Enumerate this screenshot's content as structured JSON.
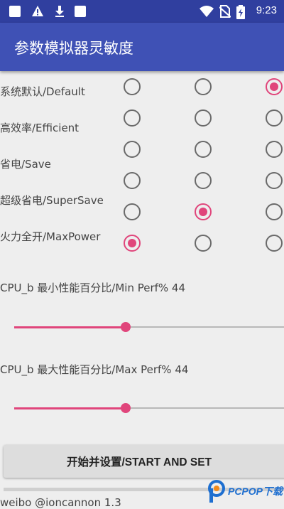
{
  "status_bar": {
    "time": "9:23",
    "left_icons": [
      "square-icon",
      "warning-icon",
      "download-icon",
      "square-icon"
    ],
    "right_icons": [
      "wifi-icon",
      "no-sim-icon",
      "battery-charging-icon"
    ]
  },
  "app_bar": {
    "title": "参数模拟器灵敏度"
  },
  "modes": {
    "rows": [
      {
        "label": "系统默认/Default",
        "selected": 2
      },
      {
        "label": "高效率/Efficient",
        "selected": -1
      },
      {
        "label": "省电/Save",
        "selected": -1
      },
      {
        "label": "超级省电/SuperSave",
        "selected": 1
      },
      {
        "label": "火力全开/MaxPower",
        "selected": 0
      }
    ]
  },
  "min_perf": {
    "label": "CPU_b 最小性能百分比/Min Perf% 44",
    "value": 44
  },
  "max_perf": {
    "label": "CPU_b 最大性能百分比/Max Perf% 44",
    "value": 44
  },
  "start_button": {
    "label": "开始并设置/START AND SET"
  },
  "footer": {
    "text": "weibo @ioncannon 1.3"
  },
  "watermark": {
    "text": "PCPOP下载"
  },
  "colors": {
    "accent": "#e0457b",
    "primary": "#3f51b5",
    "primary_dark": "#303f9f"
  }
}
